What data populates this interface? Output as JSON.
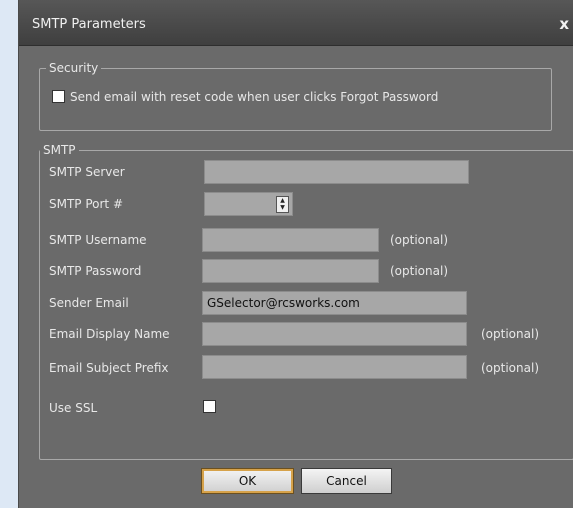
{
  "window": {
    "title": "SMTP Parameters",
    "close_glyph": "x"
  },
  "security": {
    "legend": "Security",
    "reset_code_label": "Send email with reset code when user clicks Forgot Password",
    "reset_code_checked": false
  },
  "smtp": {
    "legend": "SMTP",
    "fields": {
      "server": {
        "label": "SMTP Server",
        "value": ""
      },
      "port": {
        "label": "SMTP Port #",
        "value": ""
      },
      "username": {
        "label": "SMTP Username",
        "value": "",
        "hint": "(optional)"
      },
      "password": {
        "label": "SMTP Password",
        "value": "",
        "hint": "(optional)"
      },
      "sender_email": {
        "label": "Sender Email",
        "value": "GSelector@rcsworks.com"
      },
      "display_name": {
        "label": "Email Display Name",
        "value": "",
        "hint": "(optional)"
      },
      "subject_prefix": {
        "label": "Email Subject Prefix",
        "value": "",
        "hint": "(optional)"
      }
    },
    "use_ssl": {
      "label": "Use SSL",
      "checked": false
    }
  },
  "buttons": {
    "ok": "OK",
    "cancel": "Cancel"
  },
  "colors": {
    "dialog_bg": "#6a6a6a",
    "titlebar_bg": "#4a4a4a",
    "field_bg": "#a7a7a7",
    "default_button_accent": "#d6a24a"
  },
  "icons": {
    "close": "close-icon",
    "spin_up": "arrow-up-icon",
    "spin_down": "arrow-down-icon"
  }
}
